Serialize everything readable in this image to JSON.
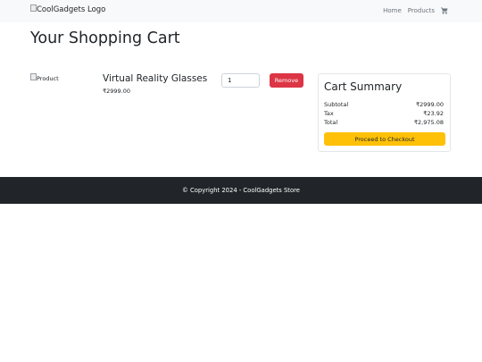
{
  "navbar": {
    "logo_alt": "CoolGadgets Logo",
    "links": [
      "Home",
      "Products"
    ],
    "cart_icon": "shopping-cart-icon"
  },
  "page": {
    "title": "Your Shopping Cart"
  },
  "cart_item": {
    "image_alt": "Product",
    "name": "Virtual Reality Glasses",
    "price": "₹2999.00",
    "quantity": "1",
    "remove_label": "Remove"
  },
  "summary": {
    "title": "Cart Summary",
    "subtotal_label": "Subtotal",
    "subtotal_value": "₹2999.00",
    "tax_label": "Tax",
    "tax_value": "₹23.92",
    "total_label": "Total",
    "total_value": "₹2,975.08",
    "checkout_label": "Proceed to Checkout"
  },
  "footer": {
    "text": "© Copyright 2024 - CoolGadgets Store"
  },
  "colors": {
    "remove": "#dc3545",
    "checkout": "#ffc107",
    "footer_bg": "#212529",
    "navbar_bg": "#f8f9fa"
  }
}
